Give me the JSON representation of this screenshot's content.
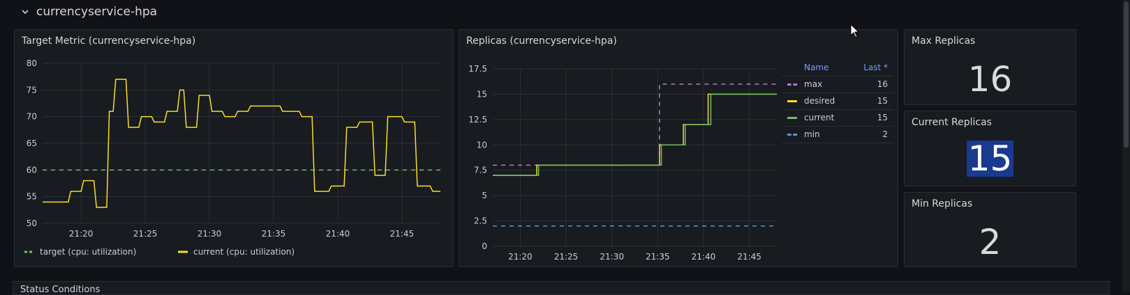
{
  "row": {
    "title": "currencyservice-hpa"
  },
  "panels": {
    "target_metric": {
      "title": "Target Metric (currencyservice-hpa)"
    },
    "replicas": {
      "title": "Replicas (currencyservice-hpa)"
    },
    "max_replicas": {
      "title": "Max Replicas",
      "value": "16"
    },
    "current_replicas": {
      "title": "Current Replicas",
      "value": "15"
    },
    "min_replicas": {
      "title": "Min Replicas",
      "value": "2"
    }
  },
  "legend_table": {
    "header_name": "Name",
    "header_last": "Last *",
    "rows": [
      {
        "name": "max",
        "last": "16",
        "color": "#b877d9",
        "dashed": true
      },
      {
        "name": "desired",
        "last": "15",
        "color": "#fade2a",
        "dashed": false
      },
      {
        "name": "current",
        "last": "15",
        "color": "#73bf69",
        "dashed": false
      },
      {
        "name": "min",
        "last": "2",
        "color": "#5794f2",
        "dashed": true
      }
    ]
  },
  "bottom_row": {
    "title": "Status Conditions"
  },
  "chart_data": [
    {
      "type": "line",
      "title": "Target Metric (currencyservice-hpa)",
      "xlabel": "",
      "ylabel": "",
      "ylim": [
        50,
        80
      ],
      "yticks": [
        50,
        55,
        60,
        65,
        70,
        75,
        80
      ],
      "xlim": [
        1037,
        1068
      ],
      "xticks": [
        1040,
        1045,
        1050,
        1055,
        1060,
        1065
      ],
      "xtick_labels": [
        "21:20",
        "21:25",
        "21:30",
        "21:35",
        "21:40",
        "21:45"
      ],
      "grid": true,
      "legend_position": "bottom-left",
      "series": [
        {
          "name": "target (cpu: utilization)",
          "color": "#73bf69",
          "dashed": true,
          "x": [
            1037,
            1068
          ],
          "y": [
            60,
            60
          ]
        },
        {
          "name": "current (cpu: utilization)",
          "color": "#fade2a",
          "dashed": false,
          "x": [
            1037,
            1039,
            1039.2,
            1040,
            1040.2,
            1041,
            1041.2,
            1042,
            1042.2,
            1042.5,
            1042.7,
            1043.5,
            1043.7,
            1044.5,
            1044.7,
            1045.5,
            1045.7,
            1046.5,
            1046.7,
            1047.5,
            1047.7,
            1048,
            1048.2,
            1049,
            1049.2,
            1050,
            1050.2,
            1051,
            1051.2,
            1052,
            1052.2,
            1053,
            1053.2,
            1055.5,
            1055.7,
            1057,
            1057.2,
            1058,
            1058.2,
            1059.3,
            1059.5,
            1060.5,
            1060.7,
            1061.5,
            1061.7,
            1062.7,
            1062.9,
            1063.7,
            1063.9,
            1065,
            1065.2,
            1066,
            1066.2,
            1067.2,
            1067.4,
            1068.5
          ],
          "y": [
            54,
            54,
            56,
            56,
            58,
            58,
            53,
            53,
            71,
            71,
            77,
            77,
            68,
            68,
            70,
            70,
            69,
            69,
            71,
            71,
            75,
            75,
            68,
            68,
            74,
            74,
            71,
            71,
            70,
            70,
            71,
            71,
            72,
            72,
            71,
            71,
            70,
            70,
            56,
            56,
            57,
            57,
            68,
            68,
            69,
            69,
            59,
            59,
            70,
            70,
            69,
            69,
            57,
            57,
            56,
            56
          ]
        }
      ]
    },
    {
      "type": "line",
      "title": "Replicas (currencyservice-hpa)",
      "xlabel": "",
      "ylabel": "",
      "ylim": [
        0,
        17.5
      ],
      "yticks": [
        0,
        2.5,
        5,
        7.5,
        10,
        12.5,
        15,
        17.5
      ],
      "ytick_labels": [
        "0",
        "2.5",
        "5",
        "7.5",
        "10",
        "12.5",
        "15",
        "17.5"
      ],
      "xlim": [
        1037,
        1068
      ],
      "xticks": [
        1040,
        1045,
        1050,
        1055,
        1060,
        1065
      ],
      "xtick_labels": [
        "21:20",
        "21:25",
        "21:30",
        "21:35",
        "21:40",
        "21:45"
      ],
      "grid": true,
      "legend_position": "right",
      "series": [
        {
          "name": "max",
          "color": "#b877d9",
          "dashed": true,
          "x": [
            1037,
            1055.2,
            1055.2,
            1068
          ],
          "y": [
            8,
            8,
            16,
            16
          ]
        },
        {
          "name": "desired",
          "color": "#fade2a",
          "dashed": false,
          "x": [
            1037,
            1041.8,
            1041.8,
            1055.2,
            1055.2,
            1057.8,
            1057.8,
            1060.5,
            1060.5,
            1068
          ],
          "y": [
            7,
            7,
            8,
            8,
            10,
            10,
            12,
            12,
            15,
            15
          ]
        },
        {
          "name": "current",
          "color": "#73bf69",
          "dashed": false,
          "x": [
            1037,
            1042,
            1042,
            1055.4,
            1055.4,
            1058,
            1058,
            1060.8,
            1060.8,
            1068
          ],
          "y": [
            7,
            7,
            8,
            8,
            10,
            10,
            12,
            12,
            15,
            15
          ]
        },
        {
          "name": "min",
          "color": "#5794f2",
          "dashed": true,
          "x": [
            1037,
            1068
          ],
          "y": [
            2,
            2
          ]
        }
      ]
    }
  ]
}
